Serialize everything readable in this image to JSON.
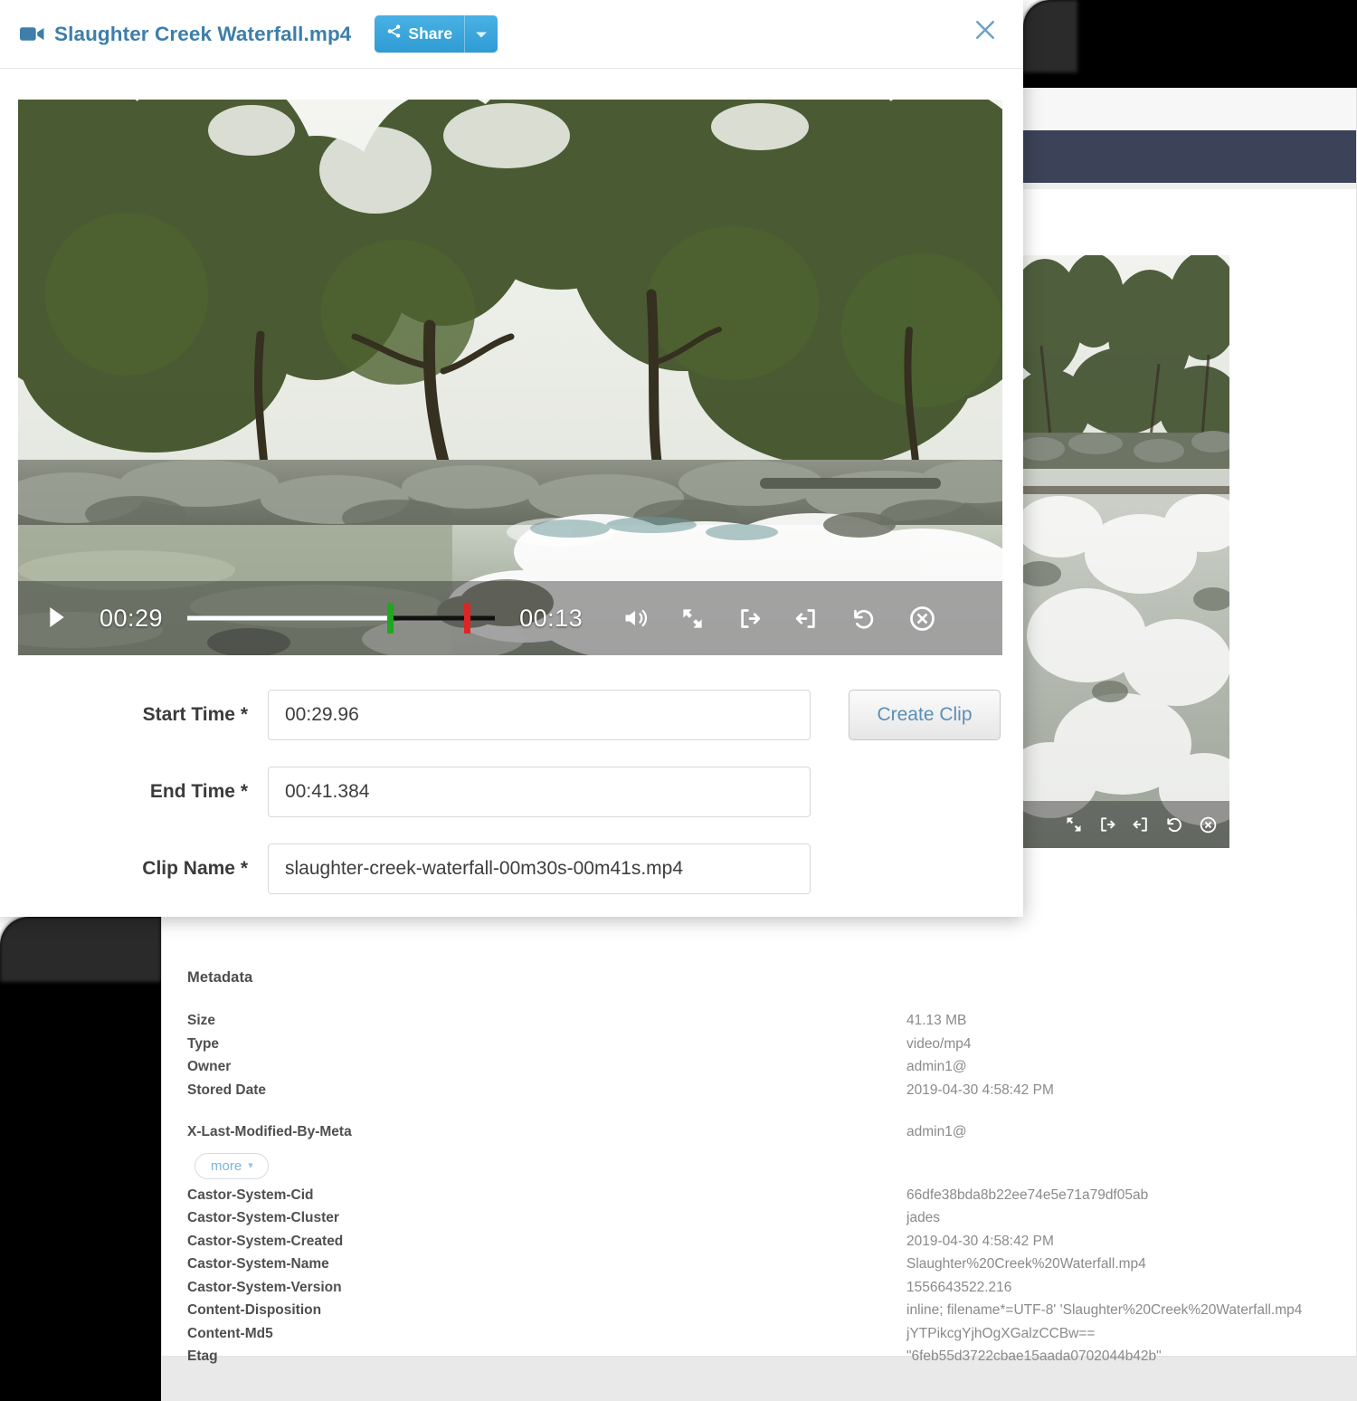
{
  "modal": {
    "title": "Slaughter Creek Waterfall.mp4",
    "title_icon": "video-camera-icon",
    "share_label": "Share",
    "share_icon": "share-icon",
    "share_caret_icon": "caret-down-icon",
    "close_icon": "close-icon"
  },
  "player": {
    "play_icon": "play-icon",
    "current_time": "00:29",
    "remaining_time": "00:13",
    "progress_percent": 66,
    "start_marker_percent": 66,
    "end_marker_percent": 91,
    "start_marker_color": "#1fa81f",
    "end_marker_color": "#e02424",
    "controls": [
      {
        "name": "volume-icon",
        "label": "Volume"
      },
      {
        "name": "fullscreen-icon",
        "label": "Fullscreen"
      },
      {
        "name": "set-clip-start-icon",
        "label": "Set clip start"
      },
      {
        "name": "set-clip-end-icon",
        "label": "Set clip end"
      },
      {
        "name": "reset-icon",
        "label": "Reset"
      },
      {
        "name": "cancel-clip-icon",
        "label": "Cancel clip"
      }
    ]
  },
  "form": {
    "start_time": {
      "label": "Start Time *",
      "value": "00:29.96",
      "placeholder": "Start Time"
    },
    "end_time": {
      "label": "End Time *",
      "value": "00:41.384",
      "placeholder": "End Time"
    },
    "clip_name": {
      "label": "Clip Name *",
      "value": "slaughter-creek-waterfall-00m30s-00m41s.mp4",
      "placeholder": "Clip Name"
    },
    "create_clip_label": "Create Clip"
  },
  "metadata": {
    "title": "Metadata",
    "more_label": "more",
    "more_icon": "chevron-down-icon",
    "primary_rows": [
      {
        "key": "Size",
        "value": "41.13 MB"
      },
      {
        "key": "Type",
        "value": "video/mp4"
      },
      {
        "key": "Owner",
        "value": "admin1@"
      },
      {
        "key": "Stored Date",
        "value": "2019-04-30 4:58:42 PM"
      }
    ],
    "modified_row": {
      "key": "X-Last-Modified-By-Meta",
      "value": "admin1@"
    },
    "extended_rows": [
      {
        "key": "Castor-System-Cid",
        "value": "66dfe38bda8b22ee74e5e71a79df05ab"
      },
      {
        "key": "Castor-System-Cluster",
        "value": "jades"
      },
      {
        "key": "Castor-System-Created",
        "value": "2019-04-30 4:58:42 PM"
      },
      {
        "key": "Castor-System-Name",
        "value": "Slaughter%20Creek%20Waterfall.mp4"
      },
      {
        "key": "Castor-System-Version",
        "value": "1556643522.216"
      },
      {
        "key": "Content-Disposition",
        "value": "inline; filename*=UTF-8' 'Slaughter%20Creek%20Waterfall.mp4"
      },
      {
        "key": "Content-Md5",
        "value": "jYTPikcgYjhOgXGalzCCBw=="
      },
      {
        "key": "Etag",
        "value": "\"6feb55d3722cbae15aada0702044b42b\""
      }
    ]
  },
  "background_window": {
    "navbar_color": "#3c4258",
    "preview_controls": [
      {
        "name": "fullscreen-icon"
      },
      {
        "name": "set-clip-start-icon"
      },
      {
        "name": "set-clip-end-icon"
      },
      {
        "name": "reset-icon"
      },
      {
        "name": "cancel-clip-icon"
      }
    ]
  },
  "colors": {
    "accent_blue": "#36a4db",
    "title_blue": "#3d7eaa",
    "navbar_navy": "#3c4258",
    "marker_green": "#1fa81f",
    "marker_red": "#e02424"
  }
}
